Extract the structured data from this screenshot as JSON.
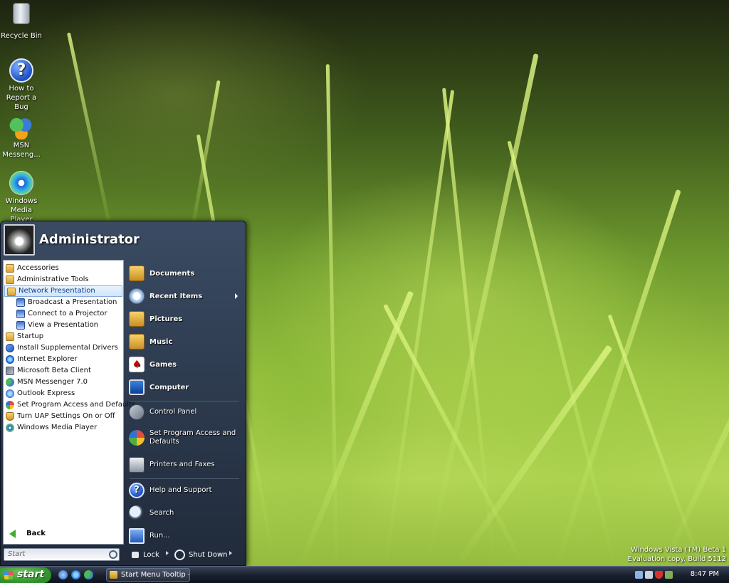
{
  "desktop": {
    "icons": [
      {
        "label": "Recycle Bin",
        "icon": "recycle-bin-icon"
      },
      {
        "label": "How to\nReport a Bug",
        "icon": "help-icon"
      },
      {
        "label": "MSN\nMesseng...",
        "icon": "msn-icon"
      },
      {
        "label": "Windows\nMedia Player",
        "icon": "media-player-icon"
      }
    ],
    "watermark": {
      "line1": "Windows Vista (TM) Beta 1",
      "line2": "Evaluation copy. Build 5112"
    }
  },
  "start_menu": {
    "user_name": "Administrator",
    "programs": [
      {
        "label": "Accessories",
        "icon": "folder-icon",
        "sub": false,
        "selected": false
      },
      {
        "label": "Administrative Tools",
        "icon": "folder-icon",
        "sub": false,
        "selected": false
      },
      {
        "label": "Network Presentation",
        "icon": "folder-icon",
        "sub": false,
        "selected": true
      },
      {
        "label": "Broadcast a Presentation",
        "icon": "presentation-icon",
        "sub": true,
        "selected": false
      },
      {
        "label": "Connect to a Projector",
        "icon": "presentation-icon",
        "sub": true,
        "selected": false
      },
      {
        "label": "View a Presentation",
        "icon": "presentation-icon",
        "sub": true,
        "selected": false
      },
      {
        "label": "Startup",
        "icon": "folder-icon",
        "sub": false,
        "selected": false
      },
      {
        "label": "Install Supplemental Drivers",
        "icon": "app-icon",
        "sub": false,
        "selected": false
      },
      {
        "label": "Internet Explorer",
        "icon": "ie-icon",
        "sub": false,
        "selected": false
      },
      {
        "label": "Microsoft Beta Client",
        "icon": "beta-icon",
        "sub": false,
        "selected": false
      },
      {
        "label": "MSN Messenger 7.0",
        "icon": "msn-icon",
        "sub": false,
        "selected": false
      },
      {
        "label": "Outlook Express",
        "icon": "outlook-icon",
        "sub": false,
        "selected": false
      },
      {
        "label": "Set Program Access and Defaults",
        "icon": "defaults-icon",
        "sub": false,
        "selected": false
      },
      {
        "label": "Turn UAP Settings On or Off",
        "icon": "uap-icon",
        "sub": false,
        "selected": false
      },
      {
        "label": "Windows Media Player",
        "icon": "media-player-icon",
        "sub": false,
        "selected": false
      }
    ],
    "back_label": "Back",
    "places": [
      {
        "label": "Documents",
        "icon": "documents-icon"
      },
      {
        "label": "Recent Items",
        "icon": "recent-items-icon"
      },
      {
        "label": "Pictures",
        "icon": "pictures-icon"
      },
      {
        "label": "Music",
        "icon": "music-icon"
      },
      {
        "label": "Games",
        "icon": "games-icon"
      },
      {
        "label": "Computer",
        "icon": "computer-icon"
      }
    ],
    "system": [
      {
        "label": "Control Panel",
        "icon": "control-panel-icon"
      },
      {
        "label": "Set Program Access and Defaults",
        "icon": "defaults-icon"
      },
      {
        "label": "Printers and Faxes",
        "icon": "printer-icon"
      }
    ],
    "tools": [
      {
        "label": "Help and Support",
        "icon": "help-icon"
      },
      {
        "label": "Search",
        "icon": "search-icon"
      },
      {
        "label": "Run...",
        "icon": "run-icon"
      }
    ],
    "search_placeholder": "Start",
    "lock_label": "Lock",
    "shutdown_label": "Shut Down"
  },
  "taskbar": {
    "start_label": "start",
    "task_button": "Start Menu Tooltip -...",
    "clock": "8:47 PM"
  }
}
